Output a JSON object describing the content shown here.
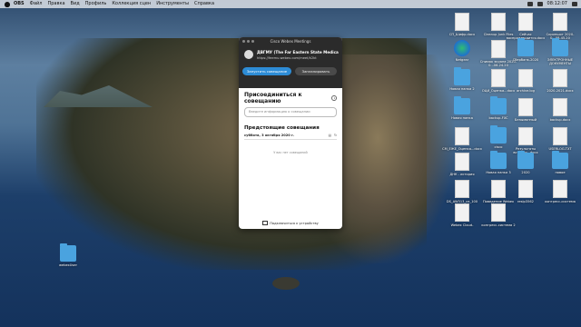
{
  "menubar": {
    "app": "OBS",
    "items": [
      "Файл",
      "Правка",
      "Вид",
      "Профиль",
      "Коллекция сцен",
      "Инструменты",
      "Справка"
    ],
    "clock": "08:12:07"
  },
  "window": {
    "title": "Cisco Webex Meetings",
    "room_name": "ДВГМУ (The Far Eastern State Medical",
    "room_url": "https://feemu.webex.com/meet/k2kt",
    "start_button": "Запустить совещание",
    "schedule_button": "Запланировать",
    "join_heading": "Присоединиться к совещанию",
    "join_placeholder": "Введите информацию о совещании",
    "upcoming_heading": "Предстоящие совещания",
    "date": "суббота, 3 октября 2020 г.",
    "empty_text": "У вас нет совещаний",
    "footer": "Подключиться к устройству"
  },
  "left_desktop_icon": "webexUser",
  "desktop_icons": [
    {
      "label": "СП_Шифр.docx",
      "type": "doc"
    },
    {
      "label": "Cleanup Junk Files",
      "type": "doc"
    },
    {
      "label": "Сейчас воспроизводится.docx",
      "type": "doc"
    },
    {
      "label": "Скриншот 2020-0...08.45.20",
      "type": "doc"
    },
    {
      "label": "Netgear",
      "type": "webex"
    },
    {
      "label": "Снимок экрана 2020-0...08.24.20",
      "type": "doc"
    },
    {
      "label": "Сбербанк-2020",
      "type": "folder"
    },
    {
      "label": "ЭЛЕКТРОННЫЕ ДОКУМЕНТЫ",
      "type": "folder"
    },
    {
      "label": "Новая папка 2",
      "type": "folder"
    },
    {
      "label": "ОЦИ_Оценка...docx",
      "type": "doc"
    },
    {
      "label": "archive.log",
      "type": "doc"
    },
    {
      "label": "2020-2021.docx",
      "type": "doc"
    },
    {
      "label": "Новая папка",
      "type": "folder"
    },
    {
      "label": "backup-FXC",
      "type": "folder"
    },
    {
      "label": "Безымянный",
      "type": "doc"
    },
    {
      "label": "backup.docx",
      "type": "doc"
    },
    {
      "label": "СМ_ЕЖЕ_Оценка...docx",
      "type": "doc"
    },
    {
      "label": "cisco",
      "type": "folder"
    },
    {
      "label": "Результаты встречи...docx",
      "type": "doc"
    },
    {
      "label": "USERLOG.TXT",
      "type": "doc"
    },
    {
      "label": "ДНК - история",
      "type": "doc"
    },
    {
      "label": "Новая папка 3",
      "type": "folder"
    },
    {
      "label": "2020",
      "type": "folder"
    },
    {
      "label": "новое",
      "type": "folder"
    },
    {
      "label": "DS_AW313_из_100",
      "type": "doc"
    },
    {
      "label": "Поведение Webex",
      "type": "doc"
    },
    {
      "label": "reslp3562",
      "type": "doc"
    },
    {
      "label": "конгресс-система",
      "type": "doc"
    },
    {
      "label": "Webex Cloud-",
      "type": "doc"
    },
    {
      "label": "конгресс-система 2",
      "type": "doc"
    }
  ]
}
